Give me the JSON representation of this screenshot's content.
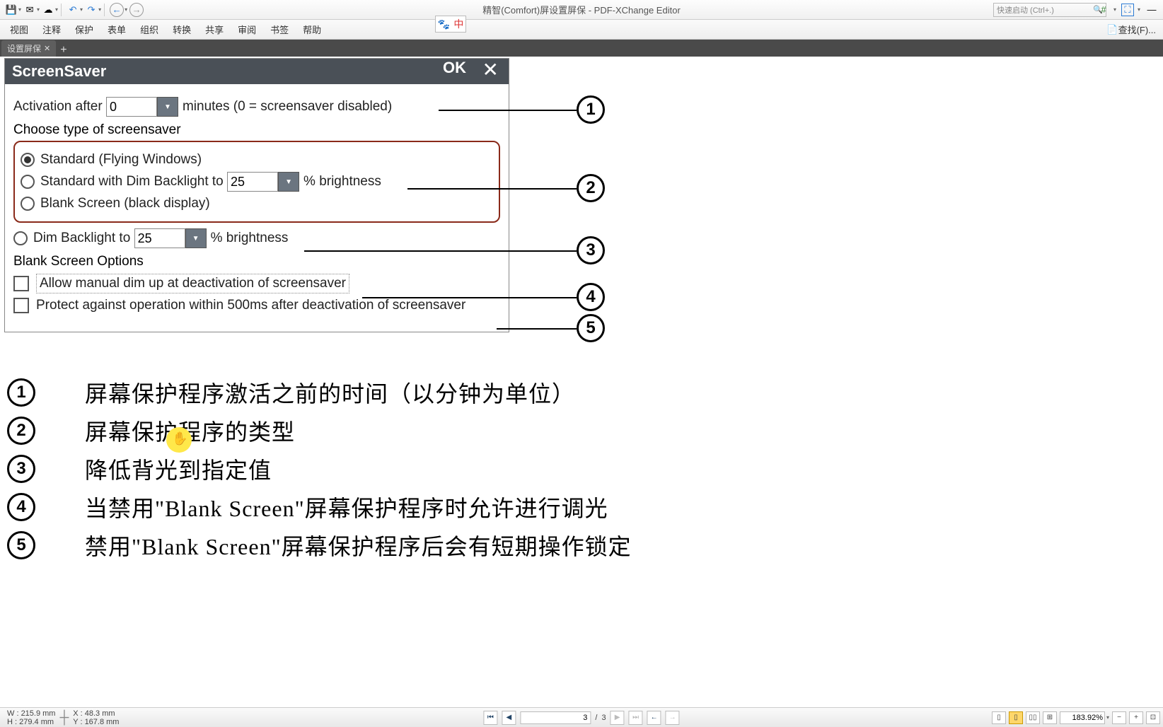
{
  "app": {
    "title": "精智(Comfort)屏设置屏保 - PDF-XChange Editor",
    "quick_launch_placeholder": "快速启动 (Ctrl+.)",
    "lang_badge_left": "🐾",
    "lang_badge_right": "中"
  },
  "menus": [
    "视图",
    "注释",
    "保护",
    "表单",
    "组织",
    "转换",
    "共享",
    "审阅",
    "书签",
    "帮助"
  ],
  "find_label": "查找(F)...",
  "tab": {
    "title": "设置屏保"
  },
  "dialog": {
    "title": "ScreenSaver",
    "ok": "OK",
    "activation_label_pre": "Activation after",
    "activation_value": "0",
    "activation_label_post": "minutes (0 = screensaver disabled)",
    "choose_label": "Choose type of screensaver",
    "opt_standard": "Standard (Flying Windows)",
    "opt_dim_pre": "Standard with Dim Backlight to",
    "opt_dim_value": "25",
    "opt_dim_post": "% brightness",
    "opt_blank": "Blank Screen (black display)",
    "dim2_pre": "Dim Backlight to",
    "dim2_value": "25",
    "dim2_post": "% brightness",
    "blank_opts_label": "Blank Screen Options",
    "chk_manual": "Allow manual dim up at deactivation of screensaver",
    "chk_protect": "Protect against operation within 500ms after deactivation of screensaver"
  },
  "callouts": [
    "1",
    "2",
    "3",
    "4",
    "5"
  ],
  "legend": [
    {
      "n": "1",
      "t": "屏幕保护程序激活之前的时间（以分钟为单位）"
    },
    {
      "n": "2",
      "t": "屏幕保护程序的类型"
    },
    {
      "n": "3",
      "t": "降低背光到指定值"
    },
    {
      "n": "4",
      "t": "当禁用\"Blank Screen\"屏幕保护程序时允许进行调光"
    },
    {
      "n": "5",
      "t": "禁用\"Blank Screen\"屏幕保护程序后会有短期操作锁定"
    }
  ],
  "status": {
    "w_label": "W : ",
    "w_val": "215.9 mm",
    "h_label": "H : ",
    "h_val": "279.4 mm",
    "x_label": "X : ",
    "x_val": "48.3 mm",
    "y_label": "Y : ",
    "y_val": "167.8 mm",
    "page_current": "3",
    "page_sep": "/",
    "page_total": "3",
    "zoom": "183.92%"
  }
}
